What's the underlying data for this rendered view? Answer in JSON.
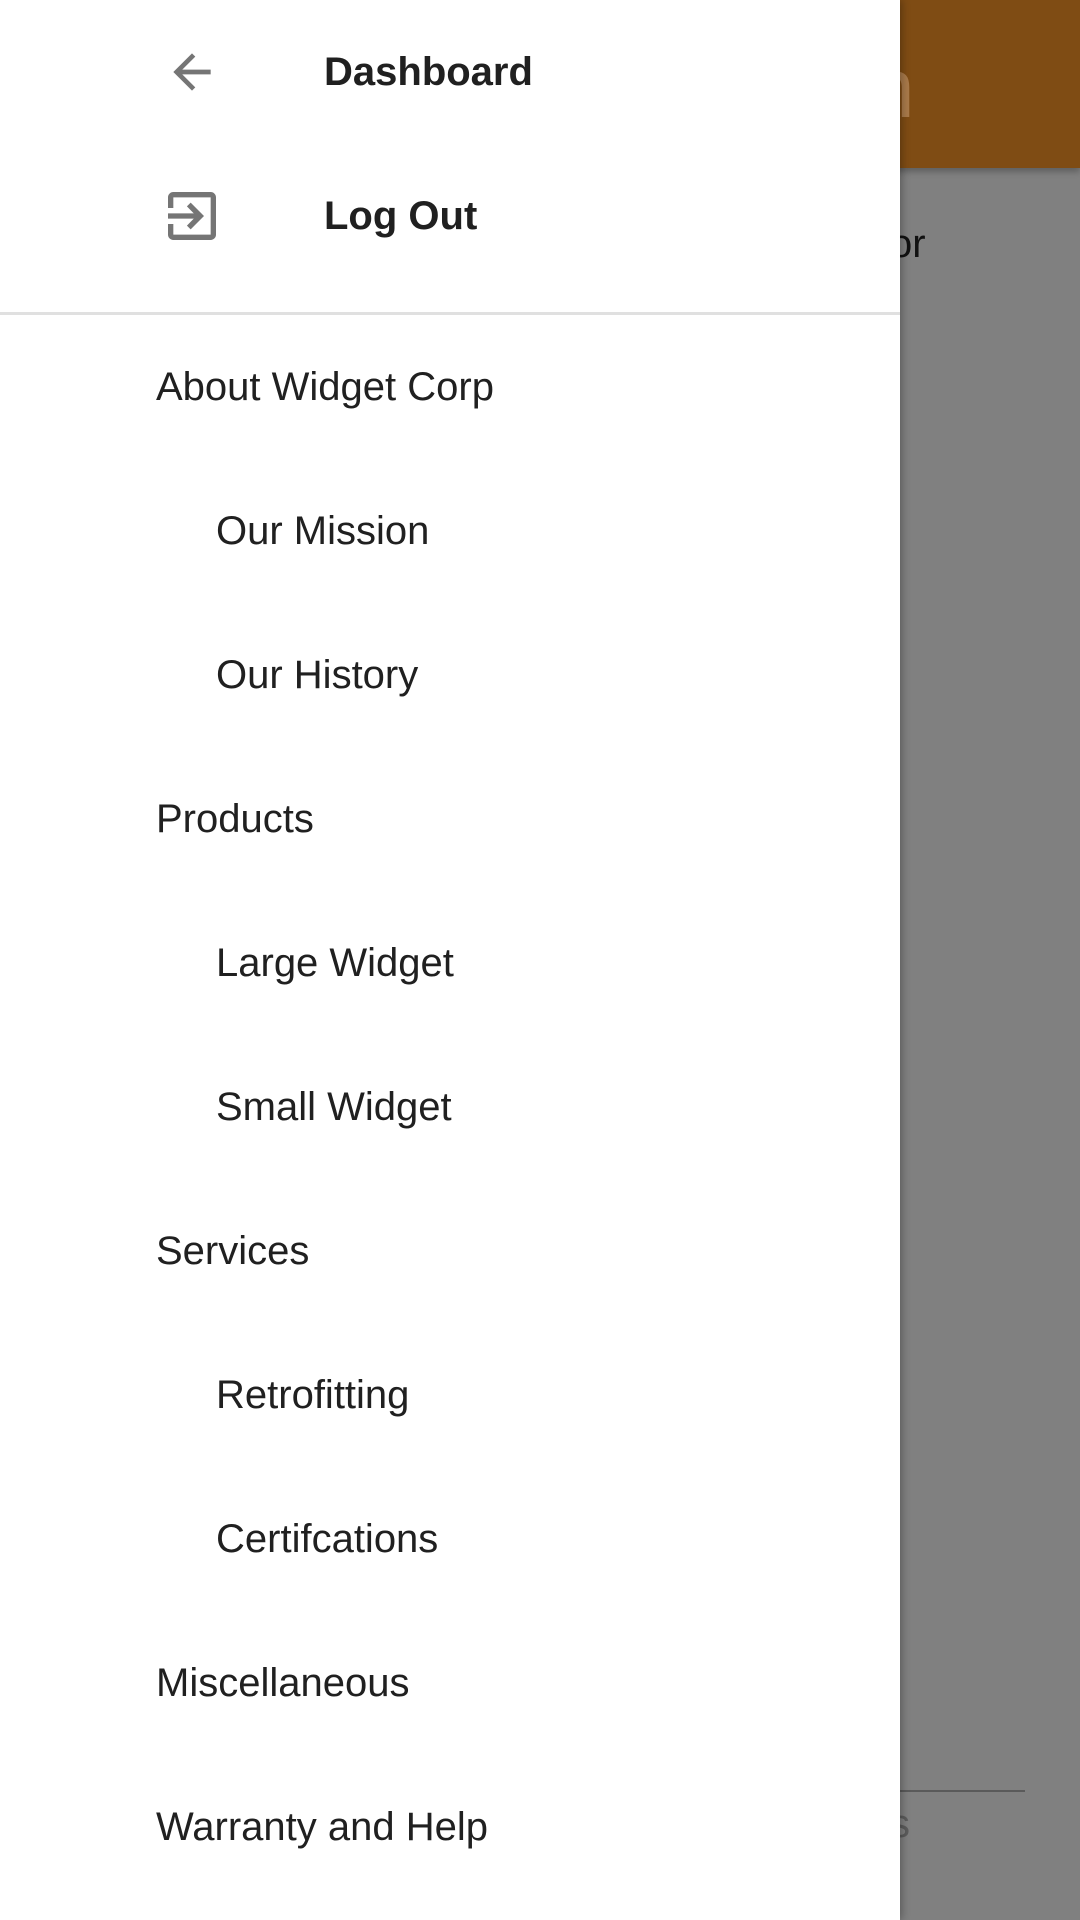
{
  "background_app": {
    "toolbar_color": "#7f4c14",
    "title_fragment": "n",
    "body_fragment": "or",
    "footer_fragment": "s"
  },
  "drawer": {
    "header_items": [
      {
        "label": "Dashboard",
        "icon": "arrow-back-icon"
      },
      {
        "label": "Log Out",
        "icon": "exit-to-app-icon"
      }
    ],
    "menu": [
      {
        "label": "About Widget Corp",
        "level": "section"
      },
      {
        "label": "Our Mission",
        "level": "sub"
      },
      {
        "label": "Our History",
        "level": "sub"
      },
      {
        "label": "Products",
        "level": "section"
      },
      {
        "label": "Large Widget",
        "level": "sub"
      },
      {
        "label": "Small Widget",
        "level": "sub"
      },
      {
        "label": "Services",
        "level": "section"
      },
      {
        "label": "Retrofitting",
        "level": "sub"
      },
      {
        "label": "Certifcations",
        "level": "sub"
      },
      {
        "label": "Miscellaneous",
        "level": "section"
      },
      {
        "label": "Warranty and Help",
        "level": "section"
      }
    ]
  }
}
